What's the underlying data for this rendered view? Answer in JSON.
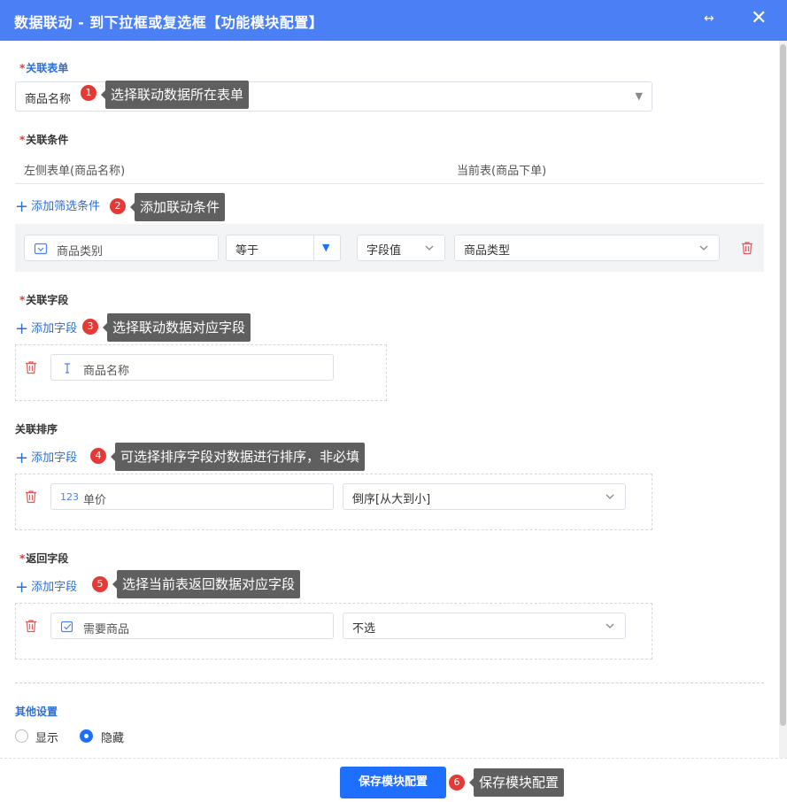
{
  "dialog": {
    "title": "数据联动 - 到下拉框或复选框【功能模块配置】"
  },
  "sections": {
    "related_form": {
      "required_mark": "*",
      "label": "关联表单",
      "selected": "商品名称"
    },
    "conditions": {
      "required_mark": "*",
      "label": "关联条件",
      "left_header": "左侧表单(商品名称)",
      "right_header": "当前表(商品下单)",
      "add_label": "添加筛选条件",
      "row": {
        "field": "商品类别",
        "operator": "等于",
        "value_type": "字段值",
        "value": "商品类型"
      }
    },
    "related_fields": {
      "required_mark": "*",
      "label": "关联字段",
      "add_label": "添加字段",
      "field": "商品名称"
    },
    "sort": {
      "label": "关联排序",
      "add_label": "添加字段",
      "field": "单价",
      "field_icon": "123",
      "order": "倒序[从大到小]"
    },
    "return_fields": {
      "required_mark": "*",
      "label": "返回字段",
      "add_label": "添加字段",
      "field": "需要商品",
      "mode": "不选"
    },
    "other": {
      "label": "其他设置",
      "options": [
        "显示",
        "隐藏"
      ],
      "selected": "隐藏"
    }
  },
  "tooltips": [
    {
      "num": "1",
      "text": "选择联动数据所在表单"
    },
    {
      "num": "2",
      "text": "添加联动条件"
    },
    {
      "num": "3",
      "text": "选择联动数据对应字段"
    },
    {
      "num": "4",
      "text": "可选择排序字段对数据进行排序，非必填"
    },
    {
      "num": "5",
      "text": "选择当前表返回数据对应字段"
    },
    {
      "num": "6",
      "text": "保存模块配置"
    }
  ],
  "footer": {
    "save_label": "保存模块配置"
  },
  "colors": {
    "titlebar": "#4a7ff5",
    "primary": "#1e6fff",
    "required": "#e53935",
    "link": "#2d6fd6",
    "tooltip": "#5f5f5f"
  }
}
